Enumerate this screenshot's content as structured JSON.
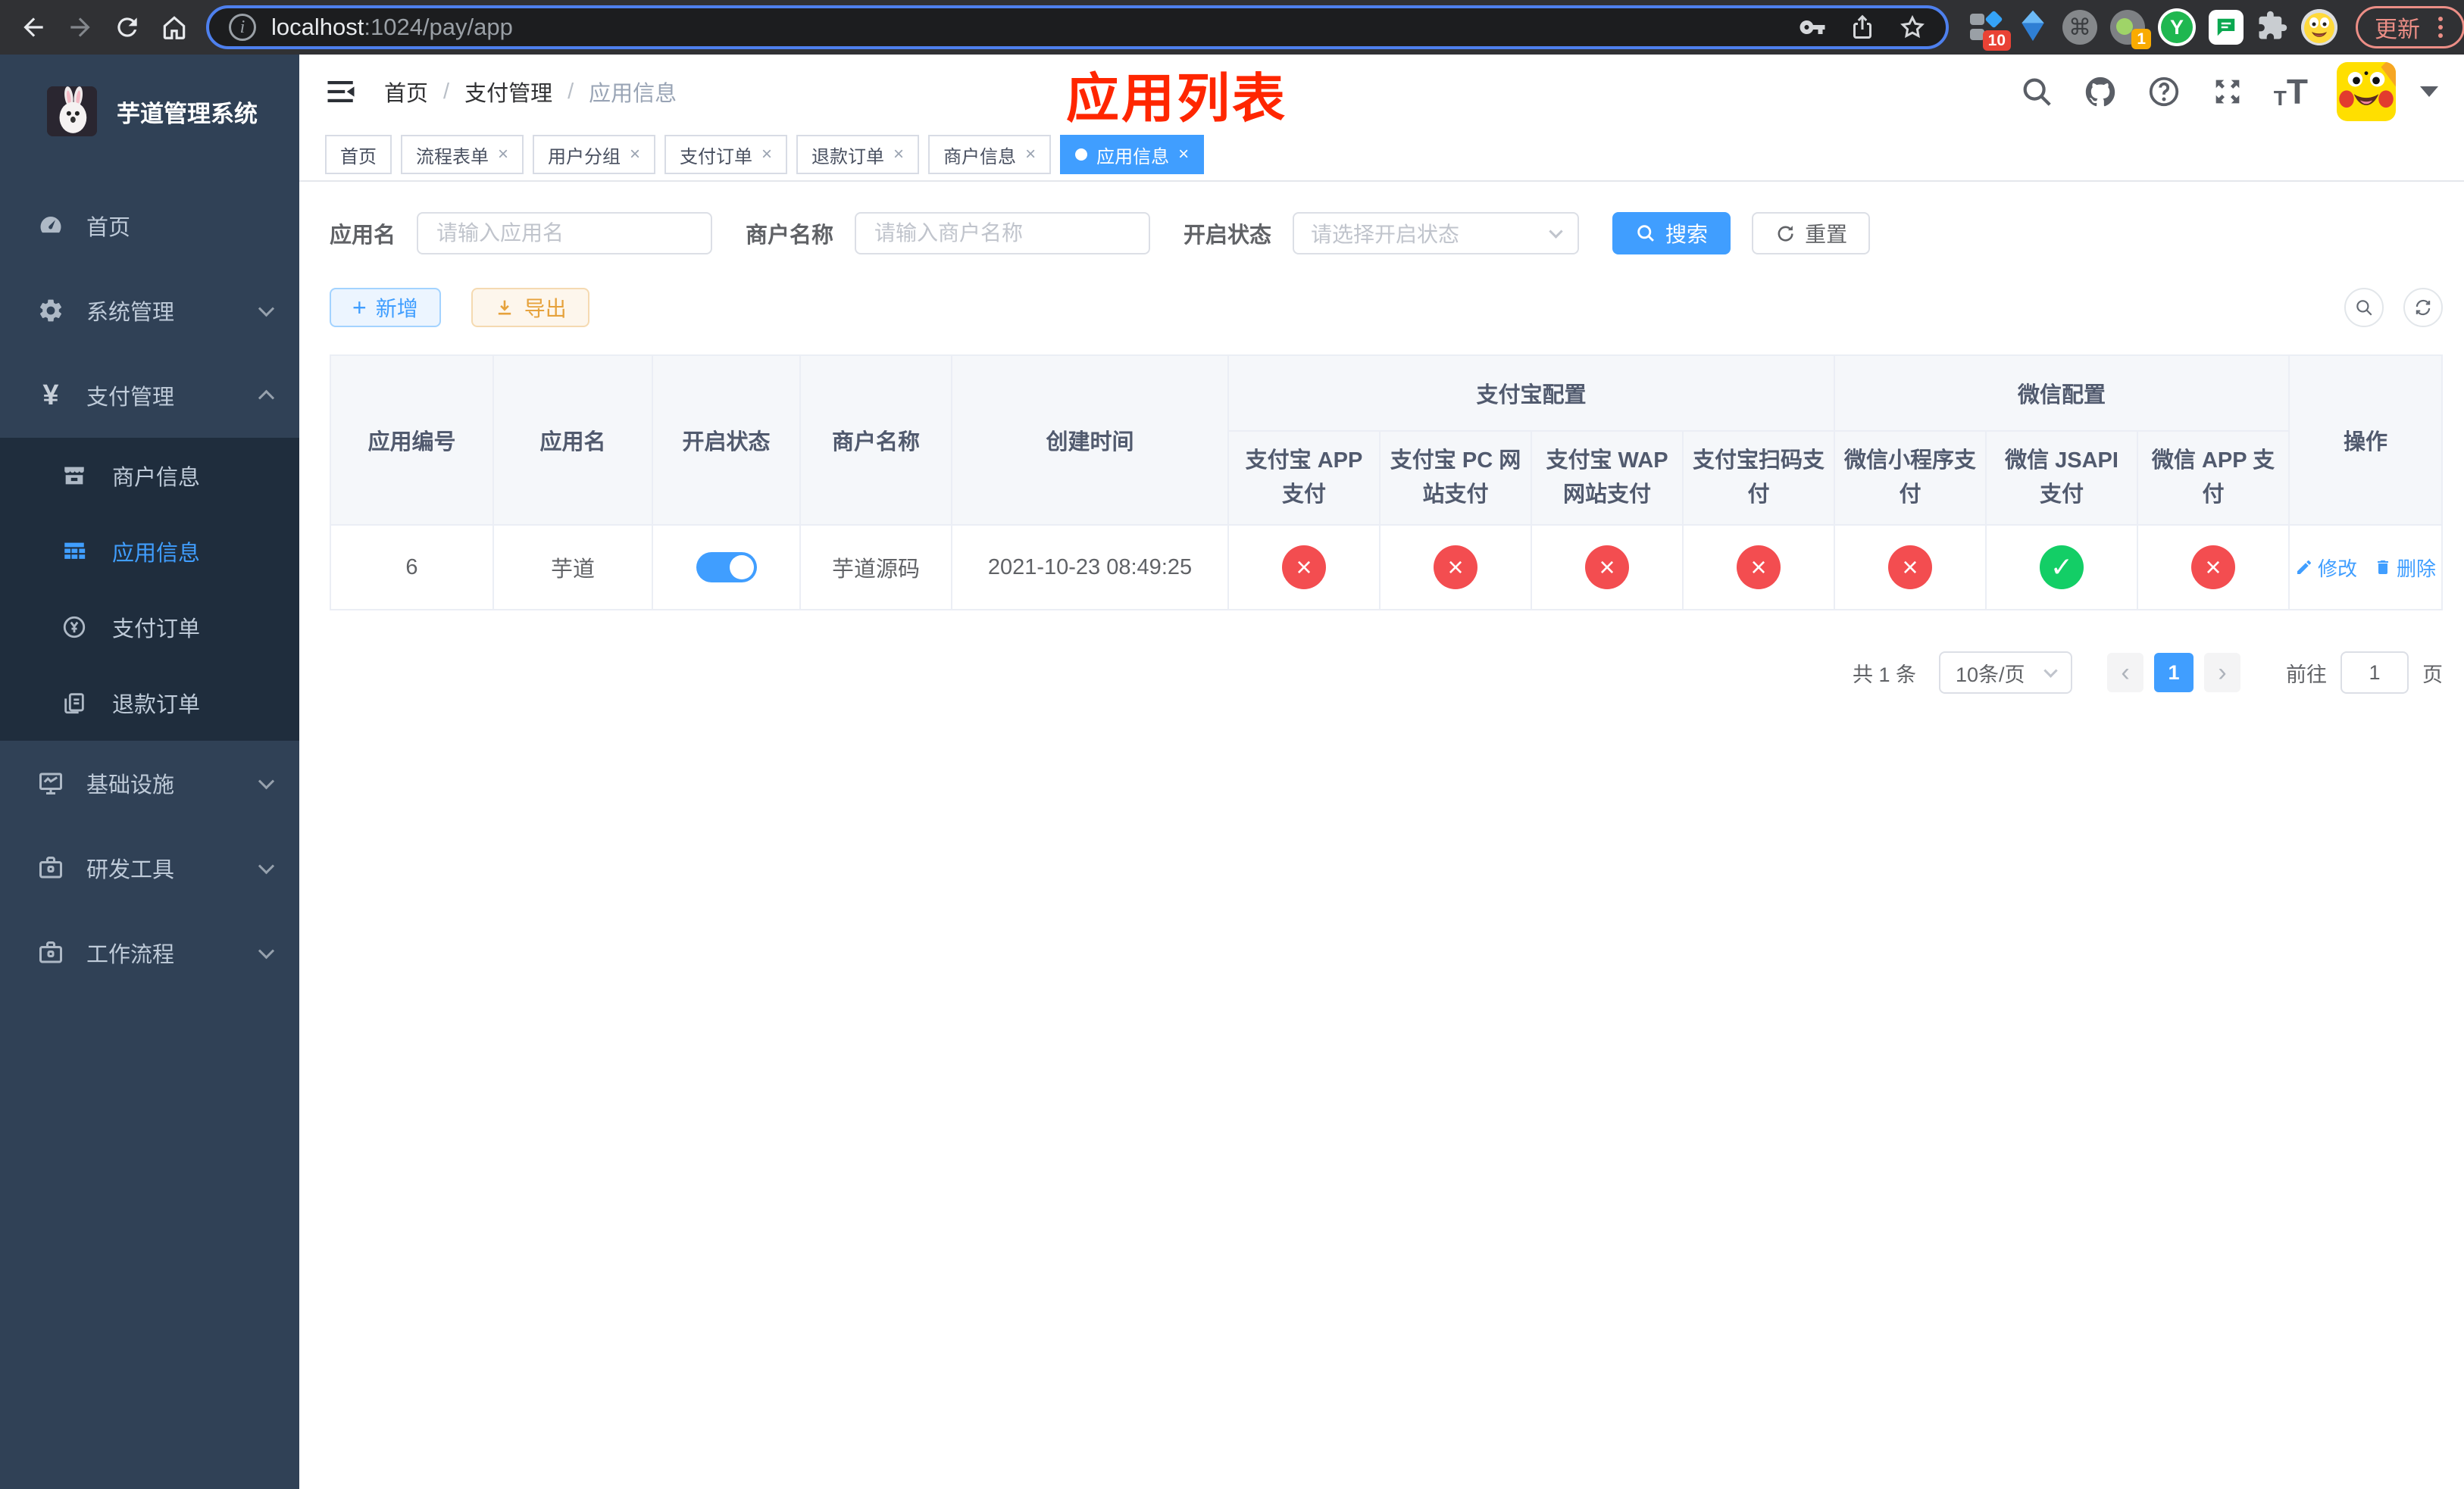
{
  "colors": {
    "accent": "#409eff",
    "danger": "#f34d50",
    "success": "#13ce66",
    "warning": "#e6a23c",
    "sidebar_bg": "#304156",
    "submenu_bg": "#1f2d3d",
    "annotation_red": "#ff2600"
  },
  "browser": {
    "url_host": "localhost",
    "url_path": ":1024/pay/app",
    "extension_badge_panels": "10",
    "extension_badge_ring": "1",
    "extension_y_letter": "Y",
    "command_glyph": "⌘",
    "update_button": "更新"
  },
  "sidebar": {
    "app_title": "芋道管理系统",
    "menu": [
      {
        "label": "首页"
      },
      {
        "label": "系统管理"
      },
      {
        "label": "支付管理"
      },
      {
        "label": "基础设施"
      },
      {
        "label": "研发工具"
      },
      {
        "label": "工作流程"
      }
    ],
    "submenu": [
      {
        "label": "商户信息"
      },
      {
        "label": "应用信息"
      },
      {
        "label": "支付订单"
      },
      {
        "label": "退款订单"
      }
    ]
  },
  "navbar": {
    "breadcrumb": [
      "首页",
      "支付管理",
      "应用信息"
    ],
    "separator": "/",
    "annotation_title": "应用列表"
  },
  "tabs": {
    "items": [
      {
        "label": "首页",
        "closable": false,
        "active": false
      },
      {
        "label": "流程表单",
        "closable": true,
        "active": false
      },
      {
        "label": "用户分组",
        "closable": true,
        "active": false
      },
      {
        "label": "支付订单",
        "closable": true,
        "active": false
      },
      {
        "label": "退款订单",
        "closable": true,
        "active": false
      },
      {
        "label": "商户信息",
        "closable": true,
        "active": false
      },
      {
        "label": "应用信息",
        "closable": true,
        "active": true
      }
    ]
  },
  "filters": {
    "app_name_label": "应用名",
    "app_name_placeholder": "请输入应用名",
    "merchant_label": "商户名称",
    "merchant_placeholder": "请输入商户名称",
    "status_label": "开启状态",
    "status_placeholder": "请选择开启状态",
    "search_button": "搜索",
    "reset_button": "重置"
  },
  "toolbar": {
    "add_button": "新增",
    "export_button": "导出"
  },
  "table": {
    "headers": {
      "app_no": "应用编号",
      "app_name": "应用名",
      "enabled": "开启状态",
      "merchant_name": "商户名称",
      "create_time": "创建时间",
      "alipay_group": "支付宝配置",
      "wechat_group": "微信配置",
      "alipay_cols": [
        "支付宝 APP 支付",
        "支付宝 PC 网站支付",
        "支付宝 WAP 网站支付",
        "支付宝扫码支付"
      ],
      "wechat_cols": [
        "微信小程序支付",
        "微信 JSAPI 支付",
        "微信 APP 支付"
      ],
      "ops": "操作"
    },
    "row": {
      "app_no": "6",
      "app_name": "芋道",
      "enabled": true,
      "merchant_name": "芋道源码",
      "create_time": "2021-10-23 08:49:25",
      "statuses": [
        "fail",
        "fail",
        "fail",
        "fail",
        "fail",
        "success",
        "fail"
      ],
      "edit_label": "修改",
      "delete_label": "删除"
    }
  },
  "pagination": {
    "total": "共 1 条",
    "page_size": "10条/页",
    "current_page": "1",
    "goto_label": "前往",
    "goto_value": "1",
    "page_unit": "页"
  }
}
